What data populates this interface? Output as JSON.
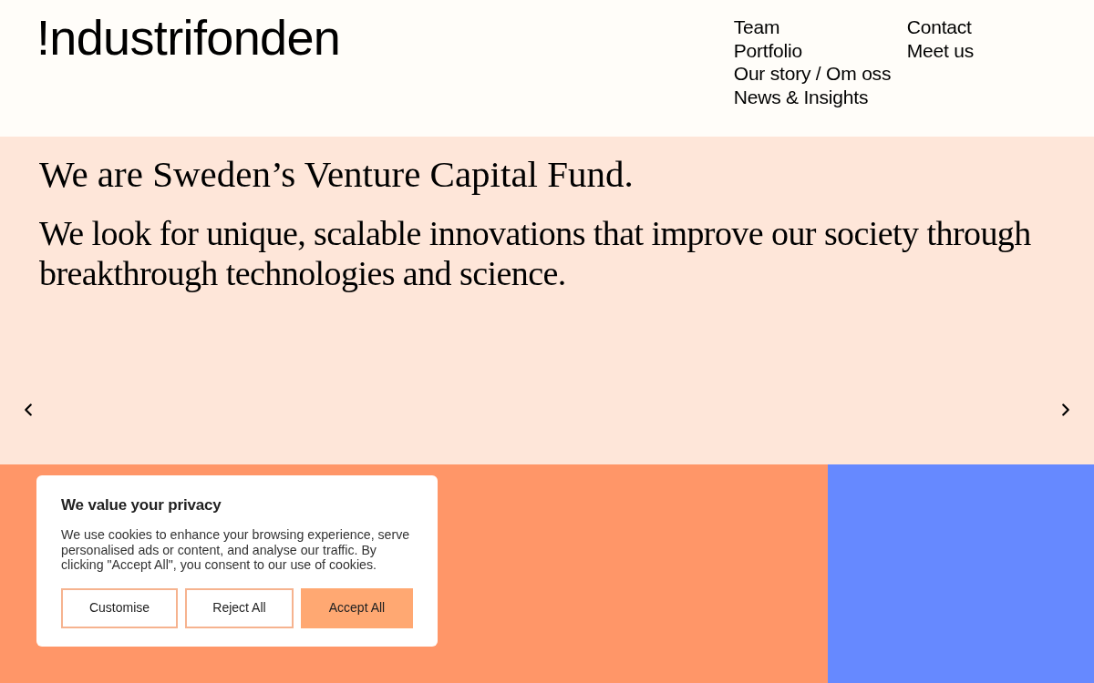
{
  "header": {
    "logo": "!ndustrifonden",
    "nav_columns": [
      {
        "items": [
          "Team",
          "Portfolio",
          "Our story / Om oss",
          "News & Insights"
        ]
      },
      {
        "items": [
          "Contact",
          "Meet us"
        ]
      }
    ]
  },
  "hero": {
    "heading": "We are Sweden’s Venture Capital Fund.",
    "text": "We look for unique, scalable innovations that improve our society through breakthrough technologies and science."
  },
  "tiles": [
    {
      "color": "#ff9668"
    },
    {
      "color": "#6689ff"
    }
  ],
  "cookie_banner": {
    "title": "We value your privacy",
    "text": "We use cookies to enhance your browsing experience, serve personalised ads or content, and analyse our traffic. By clicking \"Accept All\", you consent to our use of cookies.",
    "buttons": [
      {
        "label": "Customise",
        "kind": "outline"
      },
      {
        "label": "Reject All",
        "kind": "outline"
      },
      {
        "label": "Accept All",
        "kind": "filled"
      }
    ]
  }
}
